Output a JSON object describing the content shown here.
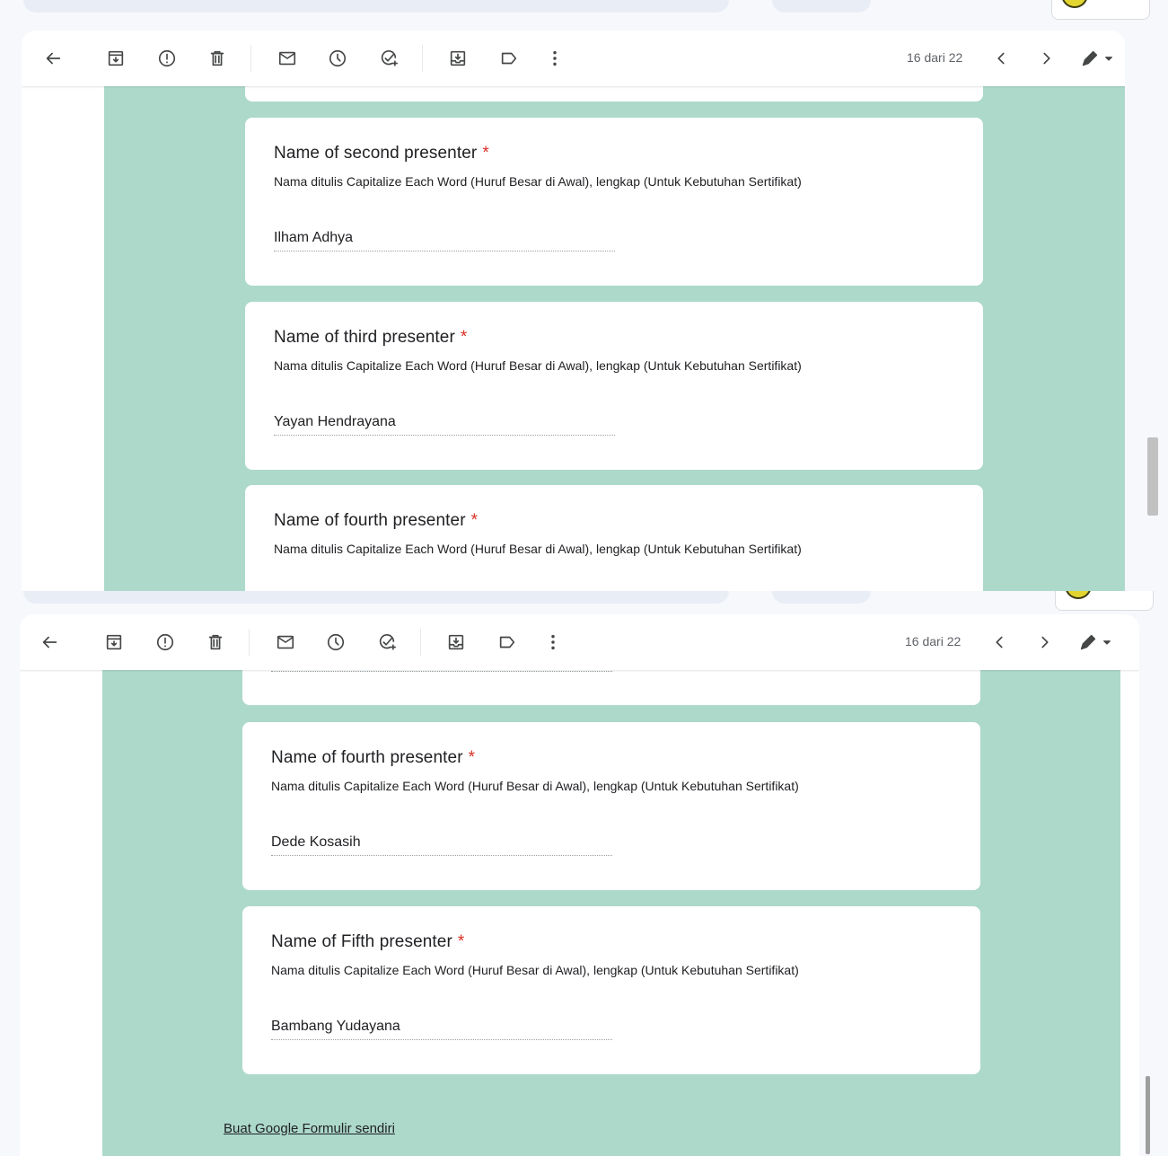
{
  "toolbar": {
    "page_count": "16 dari 22",
    "icons": [
      "back-arrow-icon",
      "archive-icon",
      "report-spam-icon",
      "delete-icon",
      "mark-unread-icon",
      "snooze-icon",
      "add-task-icon",
      "move-to-icon",
      "label-icon",
      "more-vert-icon",
      "prev-icon",
      "next-icon",
      "edit-pen-icon",
      "dropdown-icon"
    ]
  },
  "shot1": {
    "cards": [
      {
        "question": "Name of second presenter",
        "required": "*",
        "help": "Nama ditulis Capitalize Each Word (Huruf Besar di Awal), lengkap (Untuk Kebutuhan Sertifikat)",
        "answer": "Ilham Adhya"
      },
      {
        "question": "Name of third presenter",
        "required": "*",
        "help": "Nama ditulis Capitalize Each Word (Huruf Besar di Awal), lengkap (Untuk Kebutuhan Sertifikat)",
        "answer": "Yayan Hendrayana"
      },
      {
        "question": "Name of fourth presenter",
        "required": "*",
        "help": "Nama ditulis Capitalize Each Word (Huruf Besar di Awal), lengkap (Untuk Kebutuhan Sertifikat)"
      }
    ]
  },
  "shot2": {
    "cards": [
      {
        "question": "Name of fourth presenter",
        "required": "*",
        "help": "Nama ditulis Capitalize Each Word (Huruf Besar di Awal), lengkap (Untuk Kebutuhan Sertifikat)",
        "answer": "Dede Kosasih"
      },
      {
        "question": "Name of Fifth presenter",
        "required": "*",
        "help": "Nama ditulis Capitalize Each Word (Huruf Besar di Awal), lengkap (Untuk Kebutuhan Sertifikat)",
        "answer": "Bambang Yudayana"
      }
    ],
    "footer_link": "Buat Google Formulir sendiri"
  },
  "colors": {
    "form_background": "#add9cb",
    "required_star": "#d93025",
    "app_background": "#f6f8fc"
  }
}
